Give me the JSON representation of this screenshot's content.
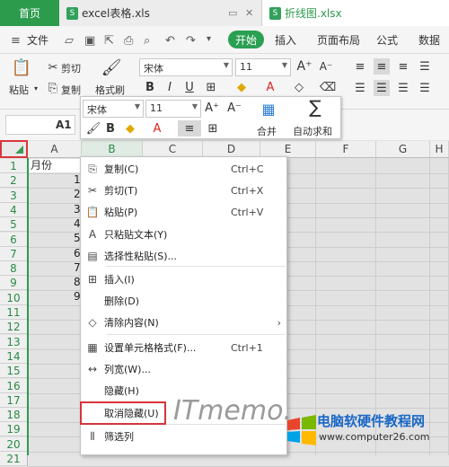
{
  "tabs": {
    "home": "首页",
    "file1": "excel表格.xls",
    "file2": "折线图.xlsx",
    "file_icon": "S"
  },
  "menu": {
    "file": "文件",
    "start": "开始",
    "insert": "插入",
    "page_layout": "页面布局",
    "formulas": "公式",
    "data": "数据"
  },
  "ribbon": {
    "paste": "粘贴",
    "cut": "剪切",
    "copy": "复制",
    "format_painter": "格式刷",
    "font_name": "宋体",
    "font_size": "11"
  },
  "namebox": "A1",
  "mini_toolbar": {
    "font_name": "宋体",
    "font_size": "11",
    "merge": "合并",
    "autosum": "自动求和"
  },
  "columns": [
    "A",
    "B",
    "C",
    "D",
    "E",
    "F",
    "G",
    "H"
  ],
  "rows": [
    "1",
    "2",
    "3",
    "4",
    "5",
    "6",
    "7",
    "8",
    "9",
    "10",
    "11",
    "12",
    "13",
    "14",
    "15",
    "16",
    "17",
    "18",
    "19",
    "20",
    "21"
  ],
  "cells": {
    "a1": "月份",
    "a_values": [
      "1",
      "2",
      "3",
      "4",
      "5",
      "6",
      "7",
      "8",
      "9"
    ]
  },
  "context_menu": [
    {
      "icon": "copy-icon",
      "glyph": "⎘",
      "label": "复制(C)",
      "shortcut": "Ctrl+C"
    },
    {
      "icon": "scissors-icon",
      "glyph": "✂",
      "label": "剪切(T)",
      "shortcut": "Ctrl+X"
    },
    {
      "icon": "paste-icon",
      "glyph": "📋",
      "label": "粘贴(P)",
      "shortcut": "Ctrl+V"
    },
    {
      "icon": "paste-text-icon",
      "glyph": "A",
      "label": "只粘贴文本(Y)",
      "shortcut": ""
    },
    {
      "icon": "paste-special-icon",
      "glyph": "▤",
      "label": "选择性粘贴(S)...",
      "shortcut": ""
    },
    {
      "icon": "insert-icon",
      "glyph": "⊞",
      "label": "插入(I)",
      "shortcut": ""
    },
    {
      "icon": "",
      "glyph": "",
      "label": "删除(D)",
      "shortcut": ""
    },
    {
      "icon": "eraser-icon",
      "glyph": "◇",
      "label": "清除内容(N)",
      "shortcut": "›"
    },
    {
      "icon": "format-cells-icon",
      "glyph": "▦",
      "label": "设置单元格格式(F)...",
      "shortcut": "Ctrl+1"
    },
    {
      "icon": "column-width-icon",
      "glyph": "↔",
      "label": "列宽(W)...",
      "shortcut": ""
    },
    {
      "icon": "",
      "glyph": "",
      "label": "隐藏(H)",
      "shortcut": ""
    },
    {
      "icon": "",
      "glyph": "",
      "label": "取消隐藏(U)",
      "shortcut": ""
    },
    {
      "icon": "filter-column-icon",
      "glyph": "⫴",
      "label": "筛选列",
      "shortcut": ""
    }
  ],
  "watermark": {
    "itmemo": "ITmemo.",
    "site_title": "电脑软硬件教程网",
    "site_url": "www.computer26.com"
  },
  "colors": {
    "accent_green": "#2aa052",
    "highlight_red": "#d8333b"
  }
}
